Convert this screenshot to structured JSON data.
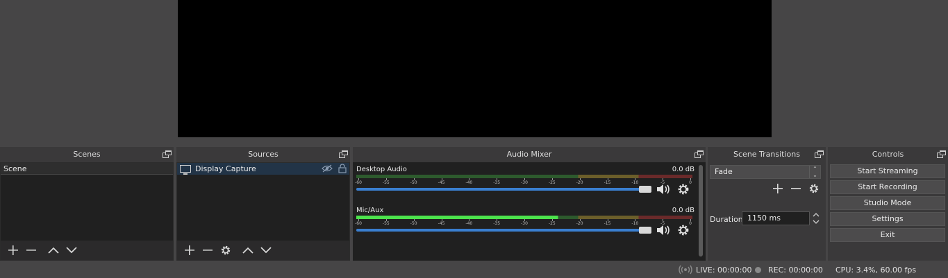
{
  "docks": {
    "scenes": {
      "title": "Scenes",
      "items": [
        "Scene"
      ]
    },
    "sources": {
      "title": "Sources",
      "items": [
        "Display Capture"
      ]
    },
    "mixer": {
      "title": "Audio Mixer",
      "channels": [
        {
          "name": "Desktop Audio",
          "db": "0.0 dB"
        },
        {
          "name": "Mic/Aux",
          "db": "0.0 dB"
        }
      ],
      "tick_labels": [
        "-60",
        "-55",
        "-50",
        "-45",
        "-40",
        "-35",
        "-30",
        "-25",
        "-20",
        "-15",
        "-10",
        "-5",
        "0"
      ]
    },
    "transitions": {
      "title": "Scene Transitions",
      "selected": "Fade",
      "duration_label": "Duration",
      "duration_value": "1150 ms"
    },
    "controls": {
      "title": "Controls",
      "buttons": [
        "Start Streaming",
        "Start Recording",
        "Studio Mode",
        "Settings",
        "Exit"
      ]
    }
  },
  "status": {
    "live": "LIVE: 00:00:00",
    "rec": "REC: 00:00:00",
    "cpu": "CPU: 3.4%, 60.00 fps"
  },
  "icons": [
    "float-icon",
    "plus-icon",
    "minus-icon",
    "gear-icon",
    "chevron-up-icon",
    "chevron-down-icon",
    "monitor-icon",
    "eye-hidden-icon",
    "lock-icon",
    "speaker-icon",
    "broadcast-icon"
  ]
}
